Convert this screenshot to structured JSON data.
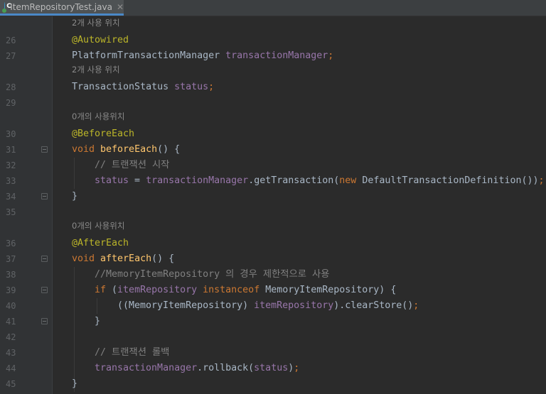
{
  "tab": {
    "title": "ItemRepositoryTest.java",
    "icon": "java-class-icon",
    "close": "✕",
    "icon_letter": "C"
  },
  "hints": {
    "uses2": "2개 사용 위치",
    "uses0": "0개의 사용위치"
  },
  "line_numbers": [
    "26",
    "27",
    "28",
    "29",
    "30",
    "31",
    "32",
    "33",
    "34",
    "35",
    "36",
    "37",
    "38",
    "39",
    "40",
    "41",
    "42",
    "43",
    "44",
    "45"
  ],
  "code": {
    "l26": "@Autowired",
    "l27a": "PlatformTransactionManager ",
    "l27b": "transactionManager",
    "l27c": ";",
    "l28a": "TransactionStatus ",
    "l28b": "status",
    "l28c": ";",
    "l30": "@BeforeEach",
    "l31a": "void ",
    "l31b": "beforeEach",
    "l31c": "() {",
    "l32": "// 트랜잭션 시작",
    "l33a": "status",
    "l33b": " = ",
    "l33c": "transactionManager",
    "l33d": ".getTransaction(",
    "l33e": "new ",
    "l33f": "DefaultTransactionDefinition())",
    "l33g": ";",
    "l34": "}",
    "l36": "@AfterEach",
    "l37a": "void ",
    "l37b": "afterEach",
    "l37c": "() {",
    "l38": "//MemoryItemRepository 의 경우 제한적으로 사용",
    "l39a": "if ",
    "l39b": "(",
    "l39c": "itemRepository ",
    "l39d": "instanceof ",
    "l39e": "MemoryItemRepository) {",
    "l40a": "((MemoryItemRepository) ",
    "l40b": "itemRepository",
    "l40c": ").clearStore()",
    "l40d": ";",
    "l41": "}",
    "l43": "// 트랜잭션 롤백",
    "l44a": "transactionManager",
    "l44b": ".rollback(",
    "l44c": "status",
    "l44d": ")",
    "l44e": ";",
    "l45": "}"
  }
}
